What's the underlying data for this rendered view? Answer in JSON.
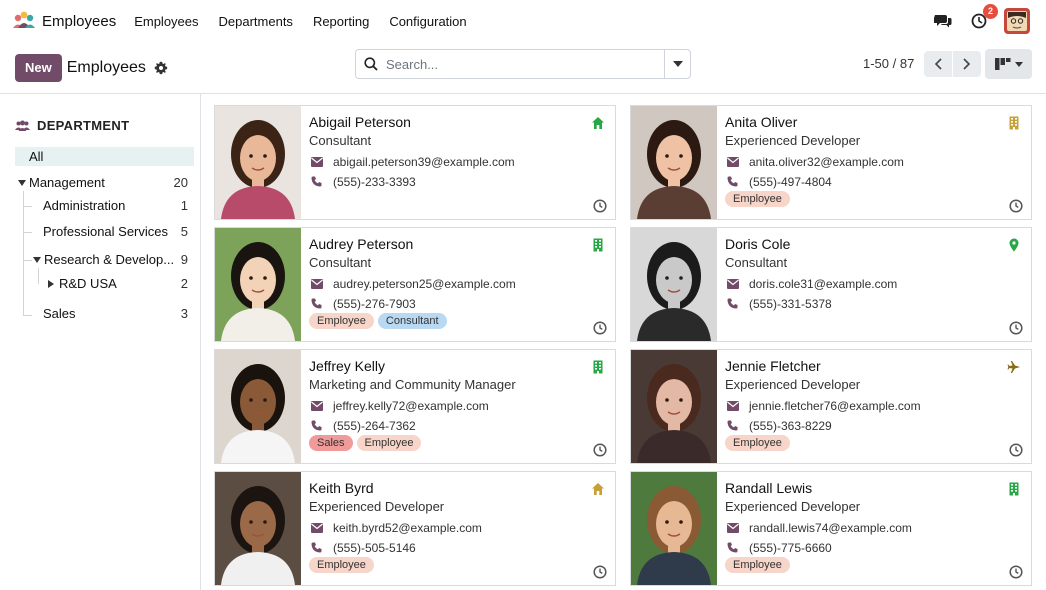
{
  "app": {
    "title": "Employees",
    "brand_colors": [
      "#e46b6b",
      "#f5b942",
      "#3aa6a6",
      "#714b67"
    ]
  },
  "menu": [
    "Employees",
    "Departments",
    "Reporting",
    "Configuration"
  ],
  "systray": {
    "activity_count": "2"
  },
  "control": {
    "new_label": "New",
    "breadcrumb": "Employees",
    "search_placeholder": "Search...",
    "pager": "1-50 / 87",
    "accent": "#714b67"
  },
  "sidebar": {
    "header": "DEPARTMENT",
    "all_label": "All",
    "items": [
      {
        "label": "Management",
        "count": "20"
      },
      {
        "label": "Administration",
        "count": "1"
      },
      {
        "label": "Professional Services",
        "count": "5"
      },
      {
        "label": "Research & Develop...",
        "count": "9"
      },
      {
        "label": "R&D USA",
        "count": "2"
      },
      {
        "label": "Sales",
        "count": "3"
      }
    ]
  },
  "employees": [
    {
      "name": "Abigail Peterson",
      "job": "Consultant",
      "email": "abigail.peterson39@example.com",
      "phone": "(555)-233-3393",
      "tags": [],
      "status_icon": "home-icon"
    },
    {
      "name": "Anita Oliver",
      "job": "Experienced Developer",
      "email": "anita.oliver32@example.com",
      "phone": "(555)-497-4804",
      "tags": [
        "Employee"
      ],
      "status_icon": "building-icon"
    },
    {
      "name": "Audrey Peterson",
      "job": "Consultant",
      "email": "audrey.peterson25@example.com",
      "phone": "(555)-276-7903",
      "tags": [
        "Employee",
        "Consultant"
      ],
      "status_icon": "building-icon"
    },
    {
      "name": "Doris Cole",
      "job": "Consultant",
      "email": "doris.cole31@example.com",
      "phone": "(555)-331-5378",
      "tags": [],
      "status_icon": "location-pin-icon"
    },
    {
      "name": "Jeffrey Kelly",
      "job": "Marketing and Community Manager",
      "email": "jeffrey.kelly72@example.com",
      "phone": "(555)-264-7362",
      "tags": [
        "Sales",
        "Employee"
      ],
      "status_icon": "building-icon"
    },
    {
      "name": "Jennie Fletcher",
      "job": "Experienced Developer",
      "email": "jennie.fletcher76@example.com",
      "phone": "(555)-363-8229",
      "tags": [
        "Employee"
      ],
      "status_icon": "plane-icon"
    },
    {
      "name": "Keith Byrd",
      "job": "Experienced Developer",
      "email": "keith.byrd52@example.com",
      "phone": "(555)-505-5146",
      "tags": [
        "Employee"
      ],
      "status_icon": "home-icon"
    },
    {
      "name": "Randall Lewis",
      "job": "Experienced Developer",
      "email": "randall.lewis74@example.com",
      "phone": "(555)-775-6660",
      "tags": [
        "Employee"
      ],
      "status_icon": "building-icon"
    }
  ]
}
